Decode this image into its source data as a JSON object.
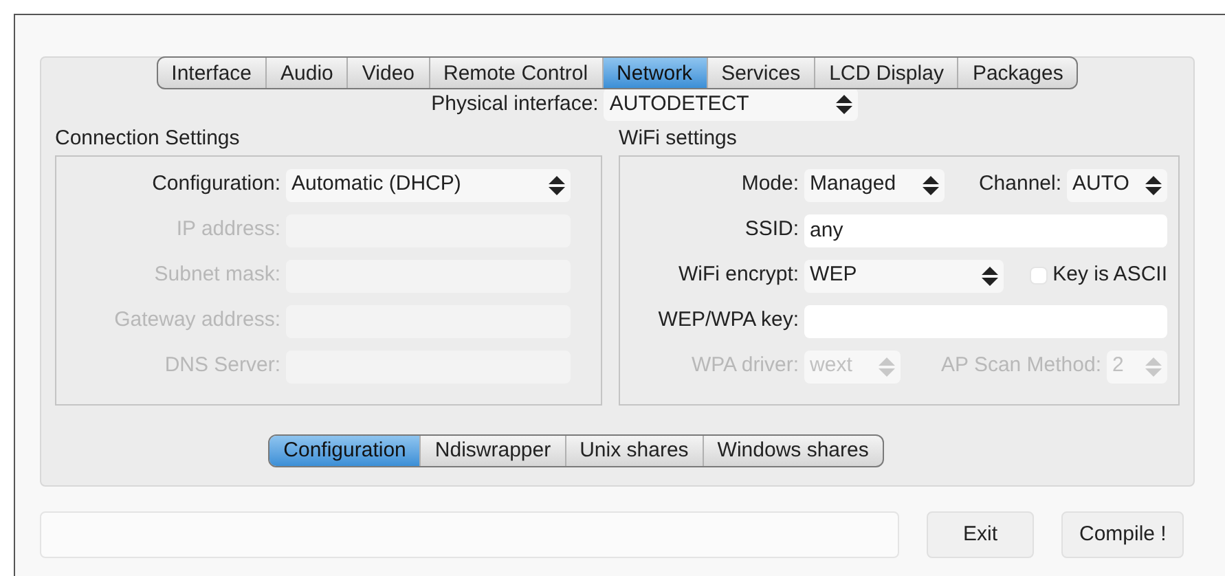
{
  "tabs": [
    {
      "label": "Interface",
      "selected": false
    },
    {
      "label": "Audio",
      "selected": false
    },
    {
      "label": "Video",
      "selected": false
    },
    {
      "label": "Remote Control",
      "selected": false
    },
    {
      "label": "Network",
      "selected": true
    },
    {
      "label": "Services",
      "selected": false
    },
    {
      "label": "LCD Display",
      "selected": false
    },
    {
      "label": "Packages",
      "selected": false
    }
  ],
  "physical_interface": {
    "label": "Physical interface:",
    "value": "AUTODETECT"
  },
  "connection_settings": {
    "title": "Connection Settings",
    "configuration": {
      "label": "Configuration:",
      "value": "Automatic (DHCP)"
    },
    "fields": [
      {
        "label": "IP address:",
        "disabled": true
      },
      {
        "label": "Subnet mask:",
        "disabled": true
      },
      {
        "label": "Gateway address:",
        "disabled": true
      },
      {
        "label": "DNS Server:",
        "disabled": true
      }
    ]
  },
  "wifi_settings": {
    "title": "WiFi settings",
    "mode": {
      "label": "Mode:",
      "value": "Managed"
    },
    "channel": {
      "label": "Channel:",
      "value": "AUTO"
    },
    "ssid": {
      "label": "SSID:",
      "value": "any"
    },
    "encrypt": {
      "label": "WiFi encrypt:",
      "value": "WEP"
    },
    "key_is_ascii": {
      "label": "Key is ASCII",
      "checked": false
    },
    "key": {
      "label": "WEP/WPA key:"
    },
    "wpa_driver": {
      "label": "WPA driver:",
      "value": "wext",
      "disabled": true
    },
    "ap_scan": {
      "label": "AP Scan Method:",
      "value": "2",
      "disabled": true
    }
  },
  "sub_tabs": [
    {
      "label": "Configuration",
      "selected": true
    },
    {
      "label": "Ndiswrapper",
      "selected": false
    },
    {
      "label": "Unix shares",
      "selected": false
    },
    {
      "label": "Windows shares",
      "selected": false
    }
  ],
  "buttons": [
    "Exit",
    "Compile !"
  ]
}
